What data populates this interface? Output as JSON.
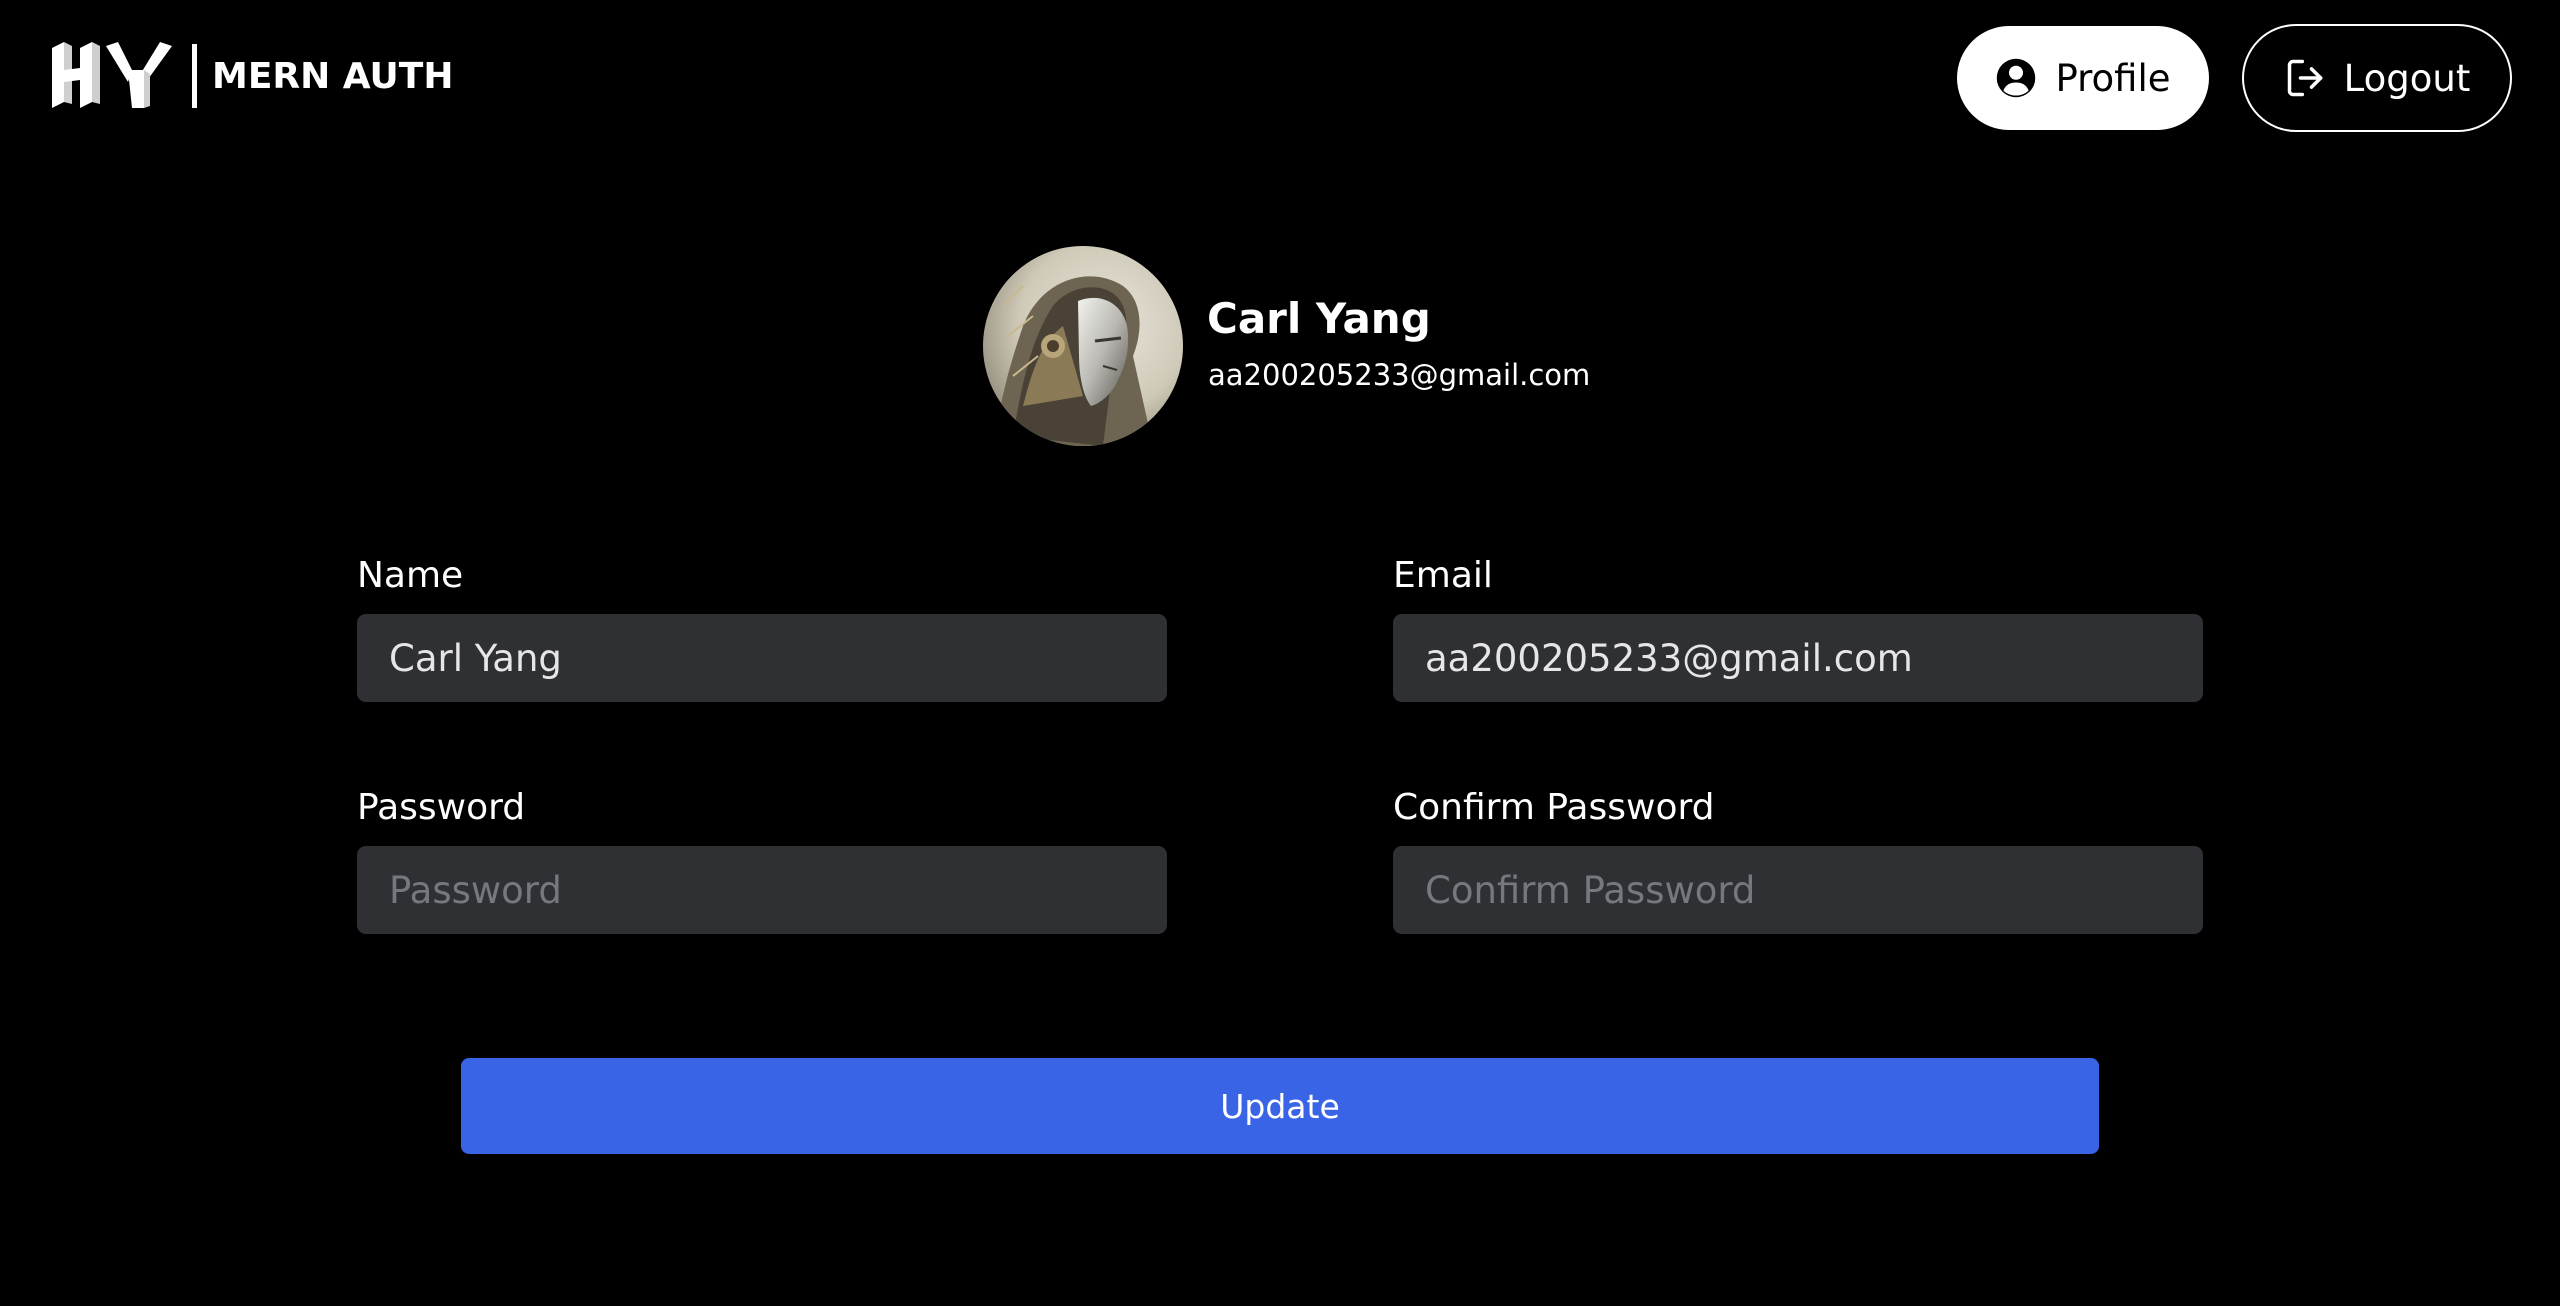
{
  "header": {
    "brand_text": "MERN AUTH",
    "logo_mark_text": "HY",
    "profile_label": "Profile",
    "logout_label": "Logout"
  },
  "user": {
    "name": "Carl Yang",
    "email": "aa200205233@gmail.com",
    "avatar_icon": "robot-portrait-avatar"
  },
  "form": {
    "name_label": "Name",
    "name_value": "Carl Yang",
    "email_label": "Email",
    "email_value": "aa200205233@gmail.com",
    "password_label": "Password",
    "password_placeholder": "Password",
    "confirm_label": "Confirm Password",
    "confirm_placeholder": "Confirm Password",
    "submit_label": "Update"
  },
  "colors": {
    "background": "#000000",
    "input_bg": "#2f3034",
    "accent": "#3964e6",
    "text": "#ffffff"
  }
}
